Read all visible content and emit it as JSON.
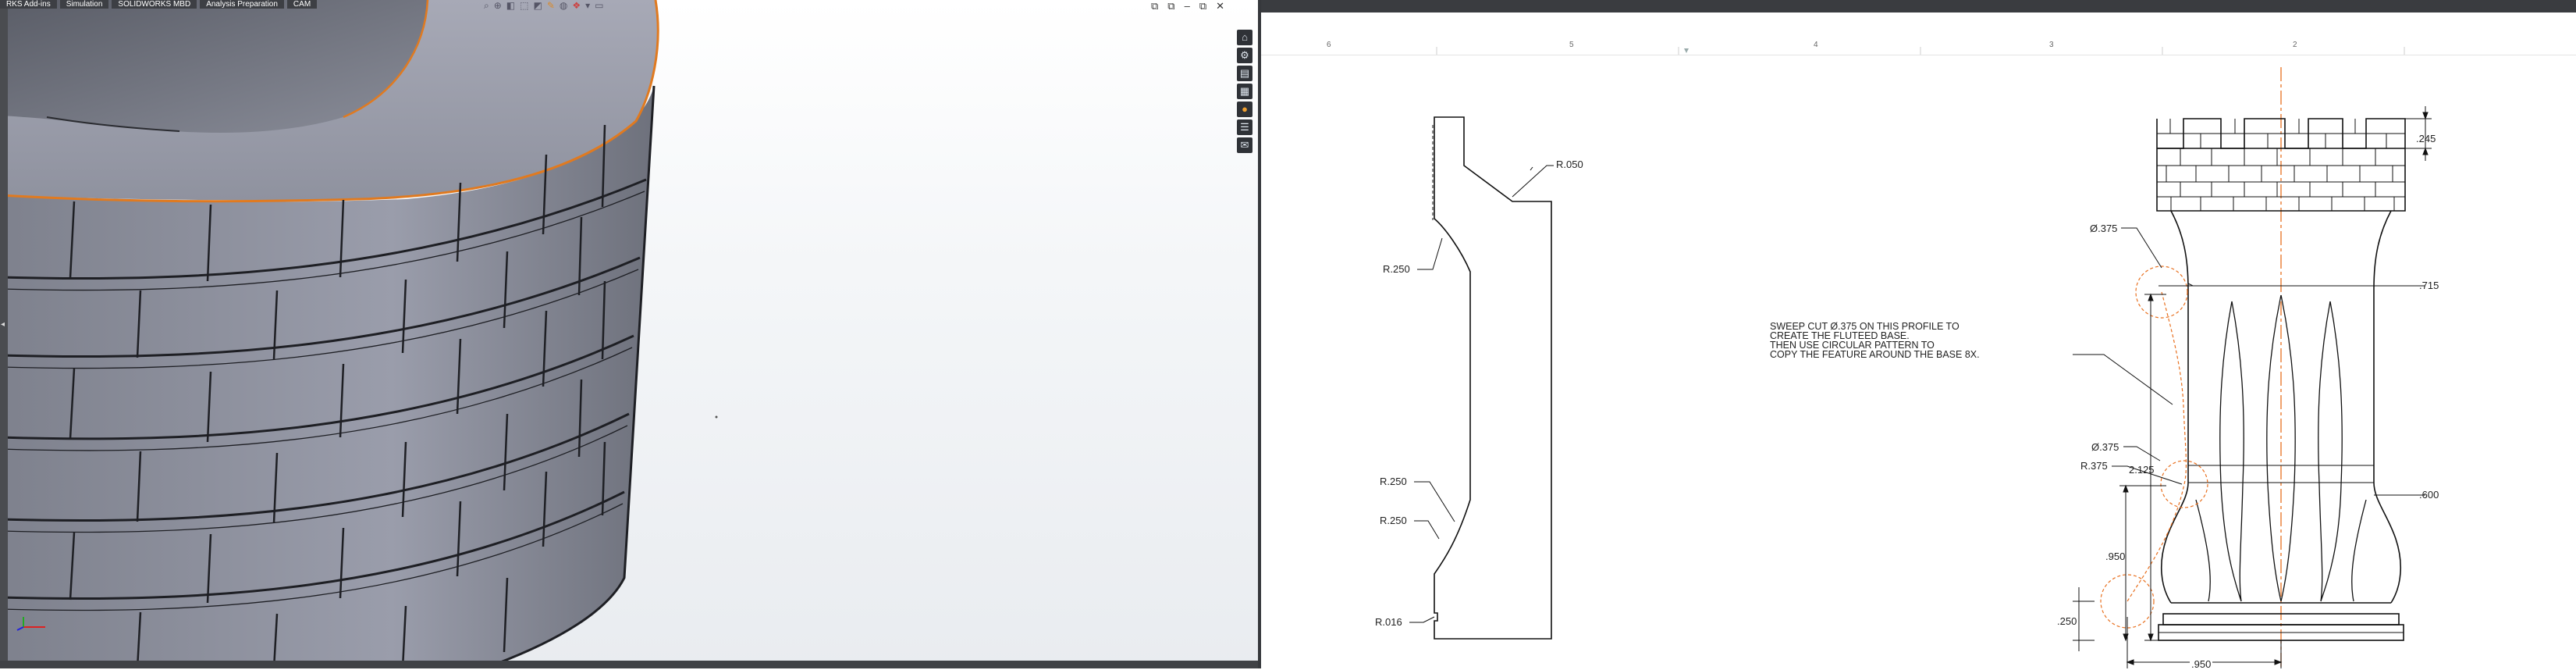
{
  "command_tabs": [
    "RKS Add-ins",
    "Simulation",
    "SOLIDWORKS MBD",
    "Analysis Preparation",
    "CAM"
  ],
  "heads_up_icons": [
    "search-view-icon",
    "zoom-icon",
    "section-view-icon",
    "view-orientation-icon",
    "display-style-icon",
    "hide-show-icon",
    "edit-appearance-icon",
    "scene-icon",
    "view-settings-icon",
    "monitor-icon"
  ],
  "window_controls": [
    "⧉",
    "⧉",
    "–",
    "⧉",
    "✕"
  ],
  "task_pane_icons": [
    "home-icon",
    "resources-icon",
    "design-library-icon",
    "file-explorer-icon",
    "appearances-icon",
    "custom-properties-icon",
    "forum-icon"
  ],
  "colors": {
    "viewport_bg_top": "#ffffff",
    "viewport_bg_bottom": "#e9ecf0",
    "model_face": "#8c8f9b",
    "model_edge": "#1e1f24",
    "selected_edge": "#e07a20",
    "dwg_line": "#111111",
    "dwg_center_line": "#e8701f"
  },
  "drawing": {
    "zones": [
      "6",
      "5",
      "4",
      "3",
      "2"
    ],
    "profile_dims": {
      "r050": "R.050",
      "r250_top": "R.250",
      "r250_mid": "R.250",
      "r250_low": "R.250",
      "r016": "R.016"
    },
    "note_lines": [
      "SWEEP CUT  Ø.375 ON THIS PROFILE TO",
      "CREATE THE FLUTEED BASE.",
      "THEN USE CIRCULAR PATTERN TO",
      "COPY THE FEATURE AROUND THE BASE 8X."
    ],
    "rook_dims": {
      "d375_top": "Ø.375",
      "d375_low": "Ø.375",
      "r375": "R.375",
      "v245": ".245",
      "v715": ".715",
      "v600": ".600",
      "h2125": "2.125",
      "h950": ".950",
      "h250": ".250",
      "w950": ".950"
    }
  }
}
